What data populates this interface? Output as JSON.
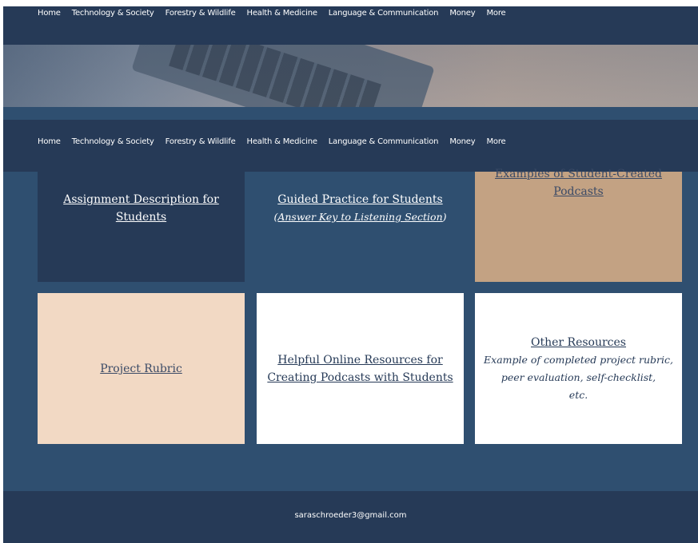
{
  "nav": {
    "items": [
      {
        "label": "Home"
      },
      {
        "label": "Technology & Society"
      },
      {
        "label": "Forestry & Wildlife"
      },
      {
        "label": "Health & Medicine"
      },
      {
        "label": "Language & Communication"
      },
      {
        "label": "Money"
      },
      {
        "label": "More"
      }
    ]
  },
  "tiles": {
    "assignment": {
      "line1": "Assignment Description for",
      "line2": "Students"
    },
    "guided": {
      "title": "Guided Practice for Students",
      "open_paren": "(",
      "answer_key": "Answer Key to Listening Section",
      "close_paren": ")"
    },
    "examples": {
      "line1": "Examples of Student-Created",
      "line2": "Podcasts"
    },
    "rubric": {
      "title": "Project Rubric"
    },
    "helpful": {
      "line1": "Helpful Online Resources for",
      "line2": "Creating Podcasts with Students"
    },
    "other": {
      "title": "Other Resources",
      "note1": "Example of completed project rubric,",
      "note2": "peer evaluation, self-checklist,",
      "note3": "etc."
    }
  },
  "footer": {
    "email": "saraschroeder3@gmail.com"
  },
  "colors": {
    "navy": "#263a57",
    "slate_blue": "#2f4f70",
    "tan": "#c3a283",
    "peach": "#f2d9c4",
    "white": "#ffffff"
  }
}
